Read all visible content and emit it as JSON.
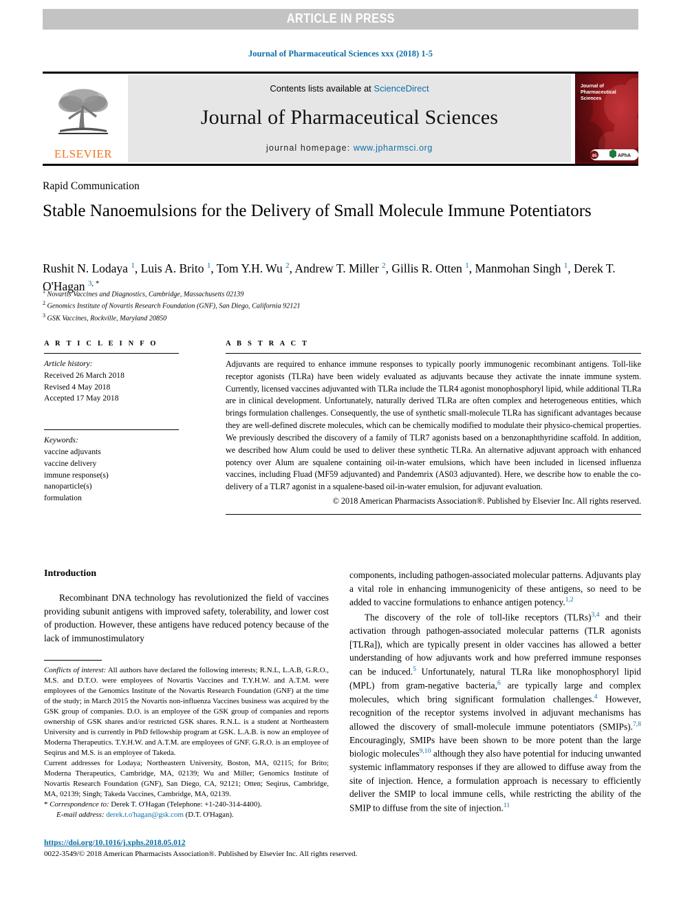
{
  "banner": {
    "label": "ARTICLE IN PRESS"
  },
  "running_head": {
    "citation": "Journal of Pharmaceutical Sciences xxx (2018) 1-5"
  },
  "masthead": {
    "publisher_name": "ELSEVIER",
    "contents_prefix": "Contents lists available at ",
    "contents_link": "ScienceDirect",
    "journal_title": "Journal of Pharmaceutical Sciences",
    "homepage_prefix": "journal homepage: ",
    "homepage_url": "www.jpharmsci.org",
    "cover_title_line1": "Journal of",
    "cover_title_line2": "Pharmaceutical",
    "cover_title_line3": "Sciences",
    "cover_badge": "APhA"
  },
  "article": {
    "type": "Rapid Communication",
    "title": "Stable Nanoemulsions for the Delivery of Small Molecule Immune Potentiators",
    "authors_html": "Rushit N. Lodaya <sup>1</sup>, Luis A. Brito <sup>1</sup>, Tom Y.H. Wu <sup>2</sup>, Andrew T. Miller <sup>2</sup>, Gillis R. Otten <sup>1</sup>, Manmohan Singh <sup>1</sup>, Derek T. O'Hagan <sup>3</sup><sup class=\"star\">, *</sup>",
    "affiliations": [
      {
        "marker": "1",
        "text": "Novartis Vaccines and Diagnostics, Cambridge, Massachusetts 02139"
      },
      {
        "marker": "2",
        "text": "Genomics Institute of Novartis Research Foundation (GNF), San Diego, California 92121"
      },
      {
        "marker": "3",
        "text": "GSK Vaccines, Rockville, Maryland 20850"
      }
    ]
  },
  "article_info": {
    "heading": "A R T I C L E   I N F O",
    "history_label": "Article history:",
    "history": [
      "Received 26 March 2018",
      "Revised 4 May 2018",
      "Accepted 17 May 2018"
    ],
    "keywords_label": "Keywords:",
    "keywords": [
      "vaccine adjuvants",
      "vaccine delivery",
      "immune response(s)",
      "nanoparticle(s)",
      "formulation"
    ]
  },
  "abstract": {
    "heading": "A B S T R A C T",
    "text": "Adjuvants are required to enhance immune responses to typically poorly immunogenic recombinant antigens. Toll-like receptor agonists (TLRa) have been widely evaluated as adjuvants because they activate the innate immune system. Currently, licensed vaccines adjuvanted with TLRa include the TLR4 agonist monophosphoryl lipid, while additional TLRa are in clinical development. Unfortunately, naturally derived TLRa are often complex and heterogeneous entities, which brings formulation challenges. Consequently, the use of synthetic small-molecule TLRa has significant advantages because they are well-defined discrete molecules, which can be chemically modified to modulate their physico-chemical properties. We previously described the discovery of a family of TLR7 agonists based on a benzonaphthyridine scaffold. In addition, we described how Alum could be used to deliver these synthetic TLRa. An alternative adjuvant approach with enhanced potency over Alum are squalene containing oil-in-water emulsions, which have been included in licensed influenza vaccines, including Fluad (MF59 adjuvanted) and Pandemrix (AS03 adjuvanted). Here, we describe how to enable the co-delivery of a TLR7 agonist in a squalene-based oil-in-water emulsion, for adjuvant evaluation.",
    "copyright": "© 2018 American Pharmacists Association®. Published by Elsevier Inc. All rights reserved."
  },
  "body": {
    "intro_heading": "Introduction",
    "left_para_1": "Recombinant DNA technology has revolutionized the field of vaccines providing subunit antigens with improved safety, tolerability, and lower cost of production. However, these antigens have reduced potency because of the lack of immunostimulatory",
    "right_para_1_a": "components, including pathogen-associated molecular patterns. Adjuvants play a vital role in enhancing immunogenicity of these antigens, so need to be added to vaccine formulations to enhance antigen potency.",
    "right_para_1_ref": "1,2",
    "right_para_2_a": "The discovery of the role of toll-like receptors (TLRs)",
    "right_para_2_ref1": "3,4",
    "right_para_2_b": " and their activation through pathogen-associated molecular patterns (TLR agonists [TLRa]), which are typically present in older vaccines has allowed a better understanding of how adjuvants work and how preferred immune responses can be induced.",
    "right_para_2_ref2": "5",
    "right_para_2_c": " Unfortunately, natural TLRa like monophosphoryl lipid (MPL) from gram-negative bacteria,",
    "right_para_2_ref3": "6",
    "right_para_2_d": " are typically large and complex molecules, which bring significant formulation challenges.",
    "right_para_2_ref4": "4",
    "right_para_2_e": " However, recognition of the receptor systems involved in adjuvant mechanisms has allowed the discovery of small-molecule immune potentiators (SMIPs).",
    "right_para_2_ref5": "7,8",
    "right_para_2_f": " Encouragingly, SMIPs have been shown to be more potent than the large biologic molecules",
    "right_para_2_ref6": "9,10",
    "right_para_2_g": " although they also have potential for inducing unwanted systemic inflammatory responses if they are allowed to diffuse away from the site of injection. Hence, a formulation approach is necessary to efficiently deliver the SMIP to local immune cells, while restricting the ability of the SMIP to diffuse from the site of injection.",
    "right_para_2_ref7": "11"
  },
  "footnotes": {
    "conflicts_label": "Conflicts of interest:",
    "conflicts_text": " All authors have declared the following interests; R.N.L, L.A.B, G.R.O., M.S. and D.T.O. were employees of Novartis Vaccines and T.Y.H.W. and A.T.M. were employees of the Genomics Institute of the Novartis Research Foundation (GNF) at the time of the study; in March 2015 the Novartis non-influenza Vaccines business was acquired by the GSK group of companies. D.O. is an employee of the GSK group of companies and reports ownership of GSK shares and/or restricted GSK shares. R.N.L. is a student at Northeastern University and is currently in PhD fellowship program at GSK. L.A.B. is now an employee of Moderna Therapeutics. T.Y.H.W. and A.T.M. are employees of GNF. G.R.O. is an employee of Seqirus and M.S. is an employee of Takeda.",
    "addresses_text": "Current addresses for Lodaya; Northeastern University, Boston, MA, 02115; for Brito; Moderna Therapeutics, Cambridge, MA, 02139; Wu and Miller; Genomics Institute of Novartis Research Foundation (GNF), San Diego, CA, 92121; Otten; Seqirus, Cambridge, MA, 02139; Singh; Takeda Vaccines, Cambridge, MA, 02139.",
    "correspondence_label": "Correspondence to:",
    "correspondence_text": " Derek T. O'Hagan (Telephone: +1-240-314-4400).",
    "email_label": "E-mail address:",
    "email": "derek.t.o'hagan@gsk.com",
    "email_suffix": " (D.T. O'Hagan)."
  },
  "footer": {
    "doi": "https://doi.org/10.1016/j.xphs.2018.05.012",
    "issn_line": "0022-3549/© 2018 American Pharmacists Association®. Published by Elsevier Inc. All rights reserved."
  },
  "colors": {
    "link_blue": "#0b6ea8",
    "elsevier_orange": "#ee7523",
    "banner_gray": "#c3c3c3",
    "masthead_gray": "#e6e6e6",
    "cover_red": "#6e0f13"
  }
}
